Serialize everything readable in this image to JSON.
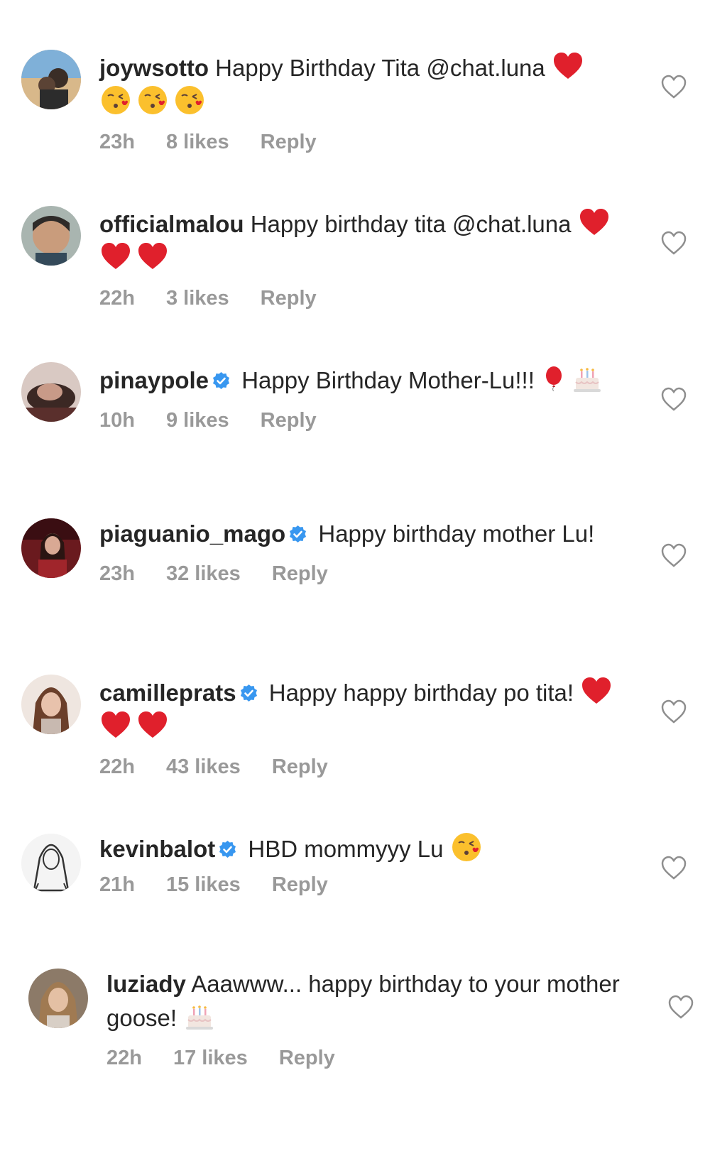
{
  "comments": [
    {
      "username": "joywsotto",
      "verified": false,
      "text_before": "Happy Birthday Tita @chat.luna",
      "emojis": [
        "red-heart",
        "kissing-face",
        "kissing-face",
        "kissing-face"
      ],
      "time": "23h",
      "likes": "8 likes",
      "reply": "Reply"
    },
    {
      "username": "officialmalou",
      "verified": false,
      "text_before": "Happy birthday tita @chat.luna",
      "emojis": [
        "red-heart",
        "red-heart",
        "red-heart"
      ],
      "time": "22h",
      "likes": "3 likes",
      "reply": "Reply"
    },
    {
      "username": "pinaypole",
      "verified": true,
      "text_before": "Happy Birthday Mother-Lu!!!",
      "emojis": [
        "balloon",
        "birthday-cake"
      ],
      "time": "10h",
      "likes": "9 likes",
      "reply": "Reply"
    },
    {
      "username": "piaguanio_mago",
      "verified": true,
      "text_before": "Happy birthday mother Lu!",
      "emojis": [],
      "time": "23h",
      "likes": "32 likes",
      "reply": "Reply"
    },
    {
      "username": "camilleprats",
      "verified": true,
      "text_before": "Happy happy birthday po tita!",
      "emojis": [
        "red-heart",
        "red-heart",
        "red-heart"
      ],
      "time": "22h",
      "likes": "43 likes",
      "reply": "Reply"
    },
    {
      "username": "kevinbalot",
      "verified": true,
      "text_before": "HBD mommyyy Lu",
      "emojis": [
        "kissing-face"
      ],
      "time": "21h",
      "likes": "15 likes",
      "reply": "Reply"
    },
    {
      "username": "luziady",
      "verified": false,
      "text_before": "Aaawww... happy birthday to your mother goose!",
      "emojis": [
        "birthday-cake"
      ],
      "time": "22h",
      "likes": "17 likes",
      "reply": "Reply"
    }
  ],
  "colors": {
    "text": "#262626",
    "meta": "#999999",
    "verified": "#3897f0",
    "heart_outline": "#8e8e8e"
  },
  "icons": {
    "like": "heart-outline-icon",
    "verified": "verified-badge-icon"
  }
}
